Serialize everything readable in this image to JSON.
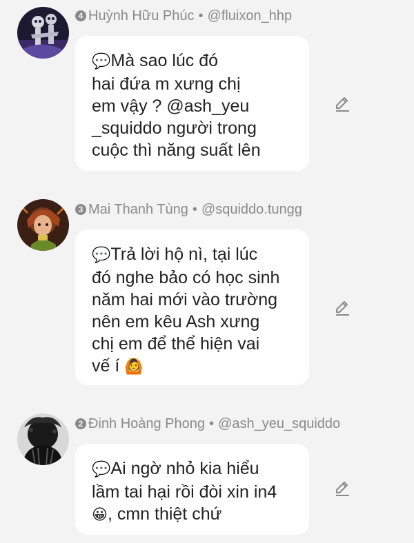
{
  "comments": [
    {
      "rank": "4",
      "author": "Huỳnh Hữu Phúc",
      "separator": "•",
      "handle": "@fluixon_hhp",
      "lead_icon": "speech-balloon-emoji",
      "lead_glyph": "💬",
      "text": "Mà sao lúc đó\nhai đứa m xưng chị\nem vậy ? @ash_yeu\n_squiddo người trong\ncuộc thì năng suất lên",
      "trail_emoji": "",
      "avatar_icon": "skeleton-couple-avatar"
    },
    {
      "rank": "3",
      "author": "Mai Thanh Tùng",
      "separator": "•",
      "handle": "@squiddo.tungg",
      "lead_icon": "speech-balloon-emoji",
      "lead_glyph": "💬",
      "text": "Trả lời hộ nì, tại lúc\nđó nghe bảo có học sinh\nnăm hai mới vào trường\nnên em kêu Ash xưng\nchị em để thể hiện vai\nvế í ",
      "trail_emoji": "🙆",
      "avatar_icon": "anime-character-avatar"
    },
    {
      "rank": "2",
      "author": "Đinh Hoàng Phong",
      "separator": "•",
      "handle": "@ash_yeu_squiddo",
      "lead_icon": "speech-balloon-emoji",
      "lead_glyph": "💬",
      "text": "Ai ngờ nhỏ kia hiểu\nlầm tai hại rồi đòi xin in4\n",
      "trail_emoji": "😀",
      "text_after": ", cmn thiệt chứ",
      "avatar_icon": "dark-silhouette-avatar"
    }
  ],
  "colors": {
    "background": "#f3f3f3",
    "bubble": "#ffffff",
    "meta_text": "#8a8a8a",
    "body_text": "#222222",
    "edit_icon": "#8a8a8a"
  }
}
